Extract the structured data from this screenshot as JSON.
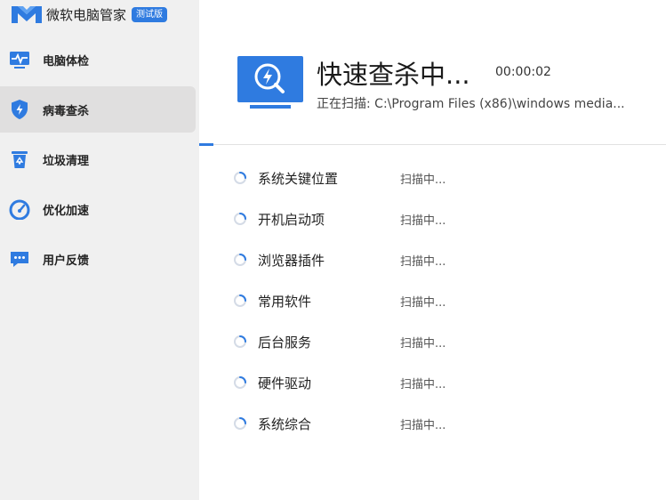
{
  "app": {
    "name": "微软电脑管家",
    "badge": "测试版"
  },
  "sidebar": {
    "items": [
      {
        "label": "电脑体检",
        "icon": "monitor-pulse-icon",
        "active": false
      },
      {
        "label": "病毒查杀",
        "icon": "shield-lightning-icon",
        "active": true
      },
      {
        "label": "垃圾清理",
        "icon": "recycle-bin-icon",
        "active": false
      },
      {
        "label": "优化加速",
        "icon": "speedometer-icon",
        "active": false
      },
      {
        "label": "用户反馈",
        "icon": "chat-bubble-icon",
        "active": false
      }
    ]
  },
  "scan": {
    "title": "快速查杀中...",
    "timer": "00:00:02",
    "path": "正在扫描: C:\\Program Files (x86)\\windows media...",
    "progress_percent": 3,
    "items": [
      {
        "label": "系统关键位置",
        "status": "扫描中..."
      },
      {
        "label": "开机启动项",
        "status": "扫描中..."
      },
      {
        "label": "浏览器插件",
        "status": "扫描中..."
      },
      {
        "label": "常用软件",
        "status": "扫描中..."
      },
      {
        "label": "后台服务",
        "status": "扫描中..."
      },
      {
        "label": "硬件驱动",
        "status": "扫描中..."
      },
      {
        "label": "系统综合",
        "status": "扫描中..."
      }
    ]
  },
  "colors": {
    "accent": "#2f7be0",
    "sidebar_bg": "#f0f0f0",
    "sidebar_active_bg": "#e0dfdf"
  }
}
